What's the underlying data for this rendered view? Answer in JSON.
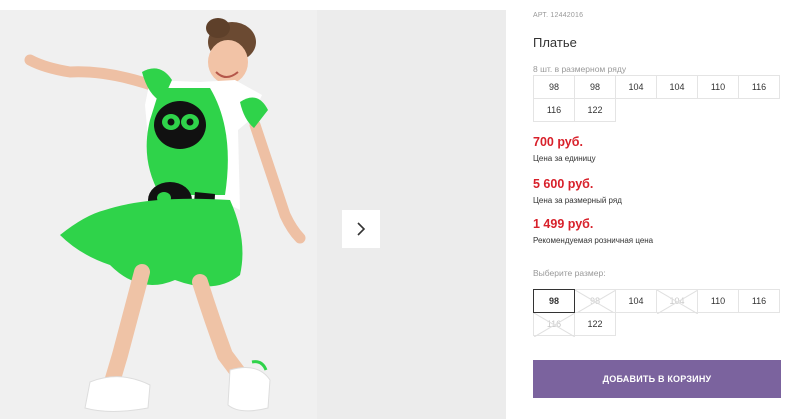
{
  "product": {
    "article": "АРТ. 12442016",
    "title": "Платье",
    "row_label": "8 шт. в размерном ряду",
    "row_sizes": [
      "98",
      "98",
      "104",
      "104",
      "110",
      "116",
      "116",
      "122"
    ],
    "prices": [
      {
        "value": "700 руб.",
        "note": "Цена за единицу"
      },
      {
        "value": "5 600 руб.",
        "note": "Цена за размерный ряд"
      },
      {
        "value": "1 499 руб.",
        "note": "Рекомендуемая розничная цена"
      }
    ],
    "choose_label": "Выберите размер:",
    "choose_sizes": [
      {
        "label": "98",
        "state": "selected"
      },
      {
        "label": "98",
        "state": "unavailable"
      },
      {
        "label": "104",
        "state": "available"
      },
      {
        "label": "104",
        "state": "unavailable"
      },
      {
        "label": "110",
        "state": "available"
      },
      {
        "label": "116",
        "state": "available"
      },
      {
        "label": "116",
        "state": "unavailable"
      },
      {
        "label": "122",
        "state": "available"
      }
    ],
    "add_to_cart": "ДОБАВИТЬ В КОРЗИНУ"
  },
  "gallery": {
    "next_icon": "chevron-right-icon"
  },
  "colors": {
    "price": "#d8202a",
    "button": "#7b639e",
    "dress_green": "#2fd34a"
  }
}
